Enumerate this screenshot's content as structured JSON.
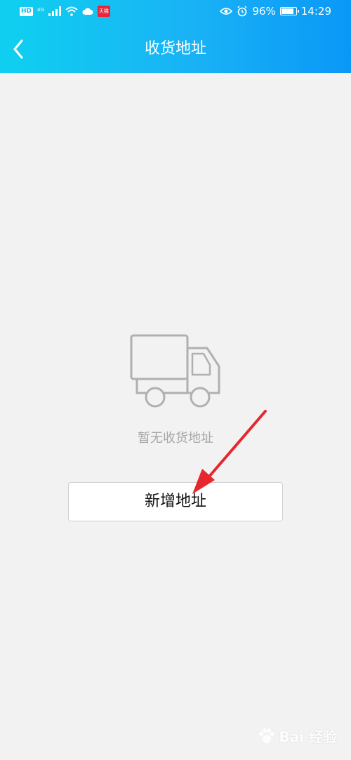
{
  "status_bar": {
    "hd": "HD",
    "network": "4G",
    "tmall": "天猫",
    "battery_percent": "96%",
    "battery_level": 0.96,
    "time": "14:29",
    "icons": [
      "signal-icon",
      "wifi-icon",
      "cloud-icon",
      "eye-icon",
      "alarm-icon",
      "battery-icon"
    ]
  },
  "nav": {
    "title": "收货地址",
    "back_icon": "chevron-left-icon"
  },
  "empty_state": {
    "icon": "truck-icon",
    "message": "暂无收货地址"
  },
  "add_button": {
    "label": "新增地址"
  },
  "annotation": {
    "arrow_color": "#e8262e"
  },
  "watermark": {
    "text": "Bai 经验"
  },
  "colors": {
    "header_start": "#0fd0f0",
    "header_end": "#0a98f7",
    "background": "#f2f2f2",
    "empty_gray": "#a6a6a6"
  }
}
